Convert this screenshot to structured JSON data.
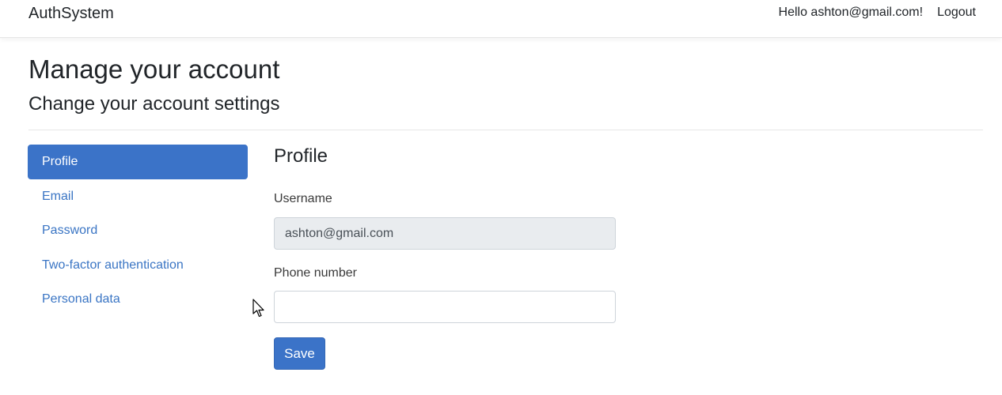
{
  "navbar": {
    "brand": "AuthSystem",
    "greeting": "Hello ashton@gmail.com!",
    "logout": "Logout"
  },
  "header": {
    "title": "Manage your account",
    "subtitle": "Change your account settings"
  },
  "sidebar": {
    "items": [
      {
        "label": "Profile",
        "active": true
      },
      {
        "label": "Email",
        "active": false
      },
      {
        "label": "Password",
        "active": false
      },
      {
        "label": "Two-factor authentication",
        "active": false
      },
      {
        "label": "Personal data",
        "active": false
      }
    ]
  },
  "profile": {
    "title": "Profile",
    "username_label": "Username",
    "username_value": "ashton@gmail.com",
    "phone_label": "Phone number",
    "phone_value": "",
    "save_label": "Save"
  },
  "colors": {
    "accent": "#3b73c8",
    "link": "#3a75c4",
    "disabled_input_bg": "#e9ecef"
  },
  "icons": {
    "cursor": "mouse-pointer-icon"
  }
}
